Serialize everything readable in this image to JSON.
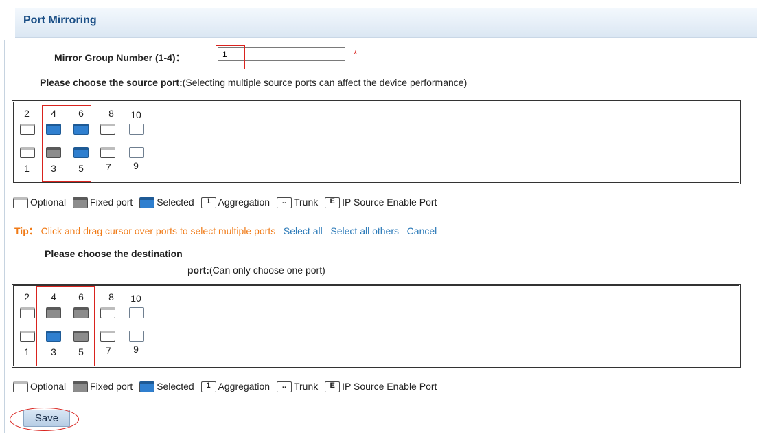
{
  "header": {
    "title": "Port Mirroring"
  },
  "group": {
    "label": "Mirror Group Number (1-4)：",
    "value": "1",
    "required_mark": "*"
  },
  "source": {
    "prompt_bold": "Please choose the source port:",
    "prompt_note": "(Selecting multiple source ports can affect the device performance)",
    "top_numbers": [
      "2",
      "4",
      "6",
      "8",
      "10"
    ],
    "bottom_numbers": [
      "1",
      "3",
      "5",
      "7",
      "9"
    ],
    "top_states": [
      "optional",
      "selected",
      "selected",
      "optional",
      "plain"
    ],
    "bottom_states": [
      "optional",
      "fixed",
      "selected",
      "optional",
      "plain"
    ]
  },
  "legend": {
    "optional": "Optional",
    "fixed": "Fixed port",
    "selected": "Selected",
    "aggregation_icon": "1",
    "aggregation": "Aggregation",
    "trunk_icon": "..",
    "trunk": "Trunk",
    "ip_icon": "E",
    "ip": "IP Source Enable Port"
  },
  "tip": {
    "label": "Tip：",
    "text": "Click and drag cursor over ports to select multiple ports",
    "select_all": "Select all",
    "select_others": "Select all others",
    "cancel": "Cancel"
  },
  "destination": {
    "prompt_bold_line1": "Please choose the destination",
    "prompt_bold_line2": "port:",
    "prompt_note": "(Can only choose one port)",
    "top_numbers": [
      "2",
      "4",
      "6",
      "8",
      "10"
    ],
    "bottom_numbers": [
      "1",
      "3",
      "5",
      "7",
      "9"
    ],
    "top_states": [
      "optional",
      "fixed",
      "fixed",
      "optional",
      "plain"
    ],
    "bottom_states": [
      "optional",
      "selected",
      "fixed",
      "optional",
      "plain"
    ]
  },
  "save": {
    "label": "Save"
  },
  "colors": {
    "accent": "#1b4f86",
    "selected": "#2f7fcf",
    "fixed": "#8c8c8c",
    "tip": "#f07a16",
    "link": "#2c7ab8",
    "highlight": "#d9231e"
  },
  "icons": {
    "optional": "optional-port-icon",
    "fixed": "fixed-port-icon",
    "selected": "selected-port-icon",
    "aggregation": "aggregation-icon",
    "trunk": "trunk-icon",
    "ip": "ip-source-icon"
  }
}
